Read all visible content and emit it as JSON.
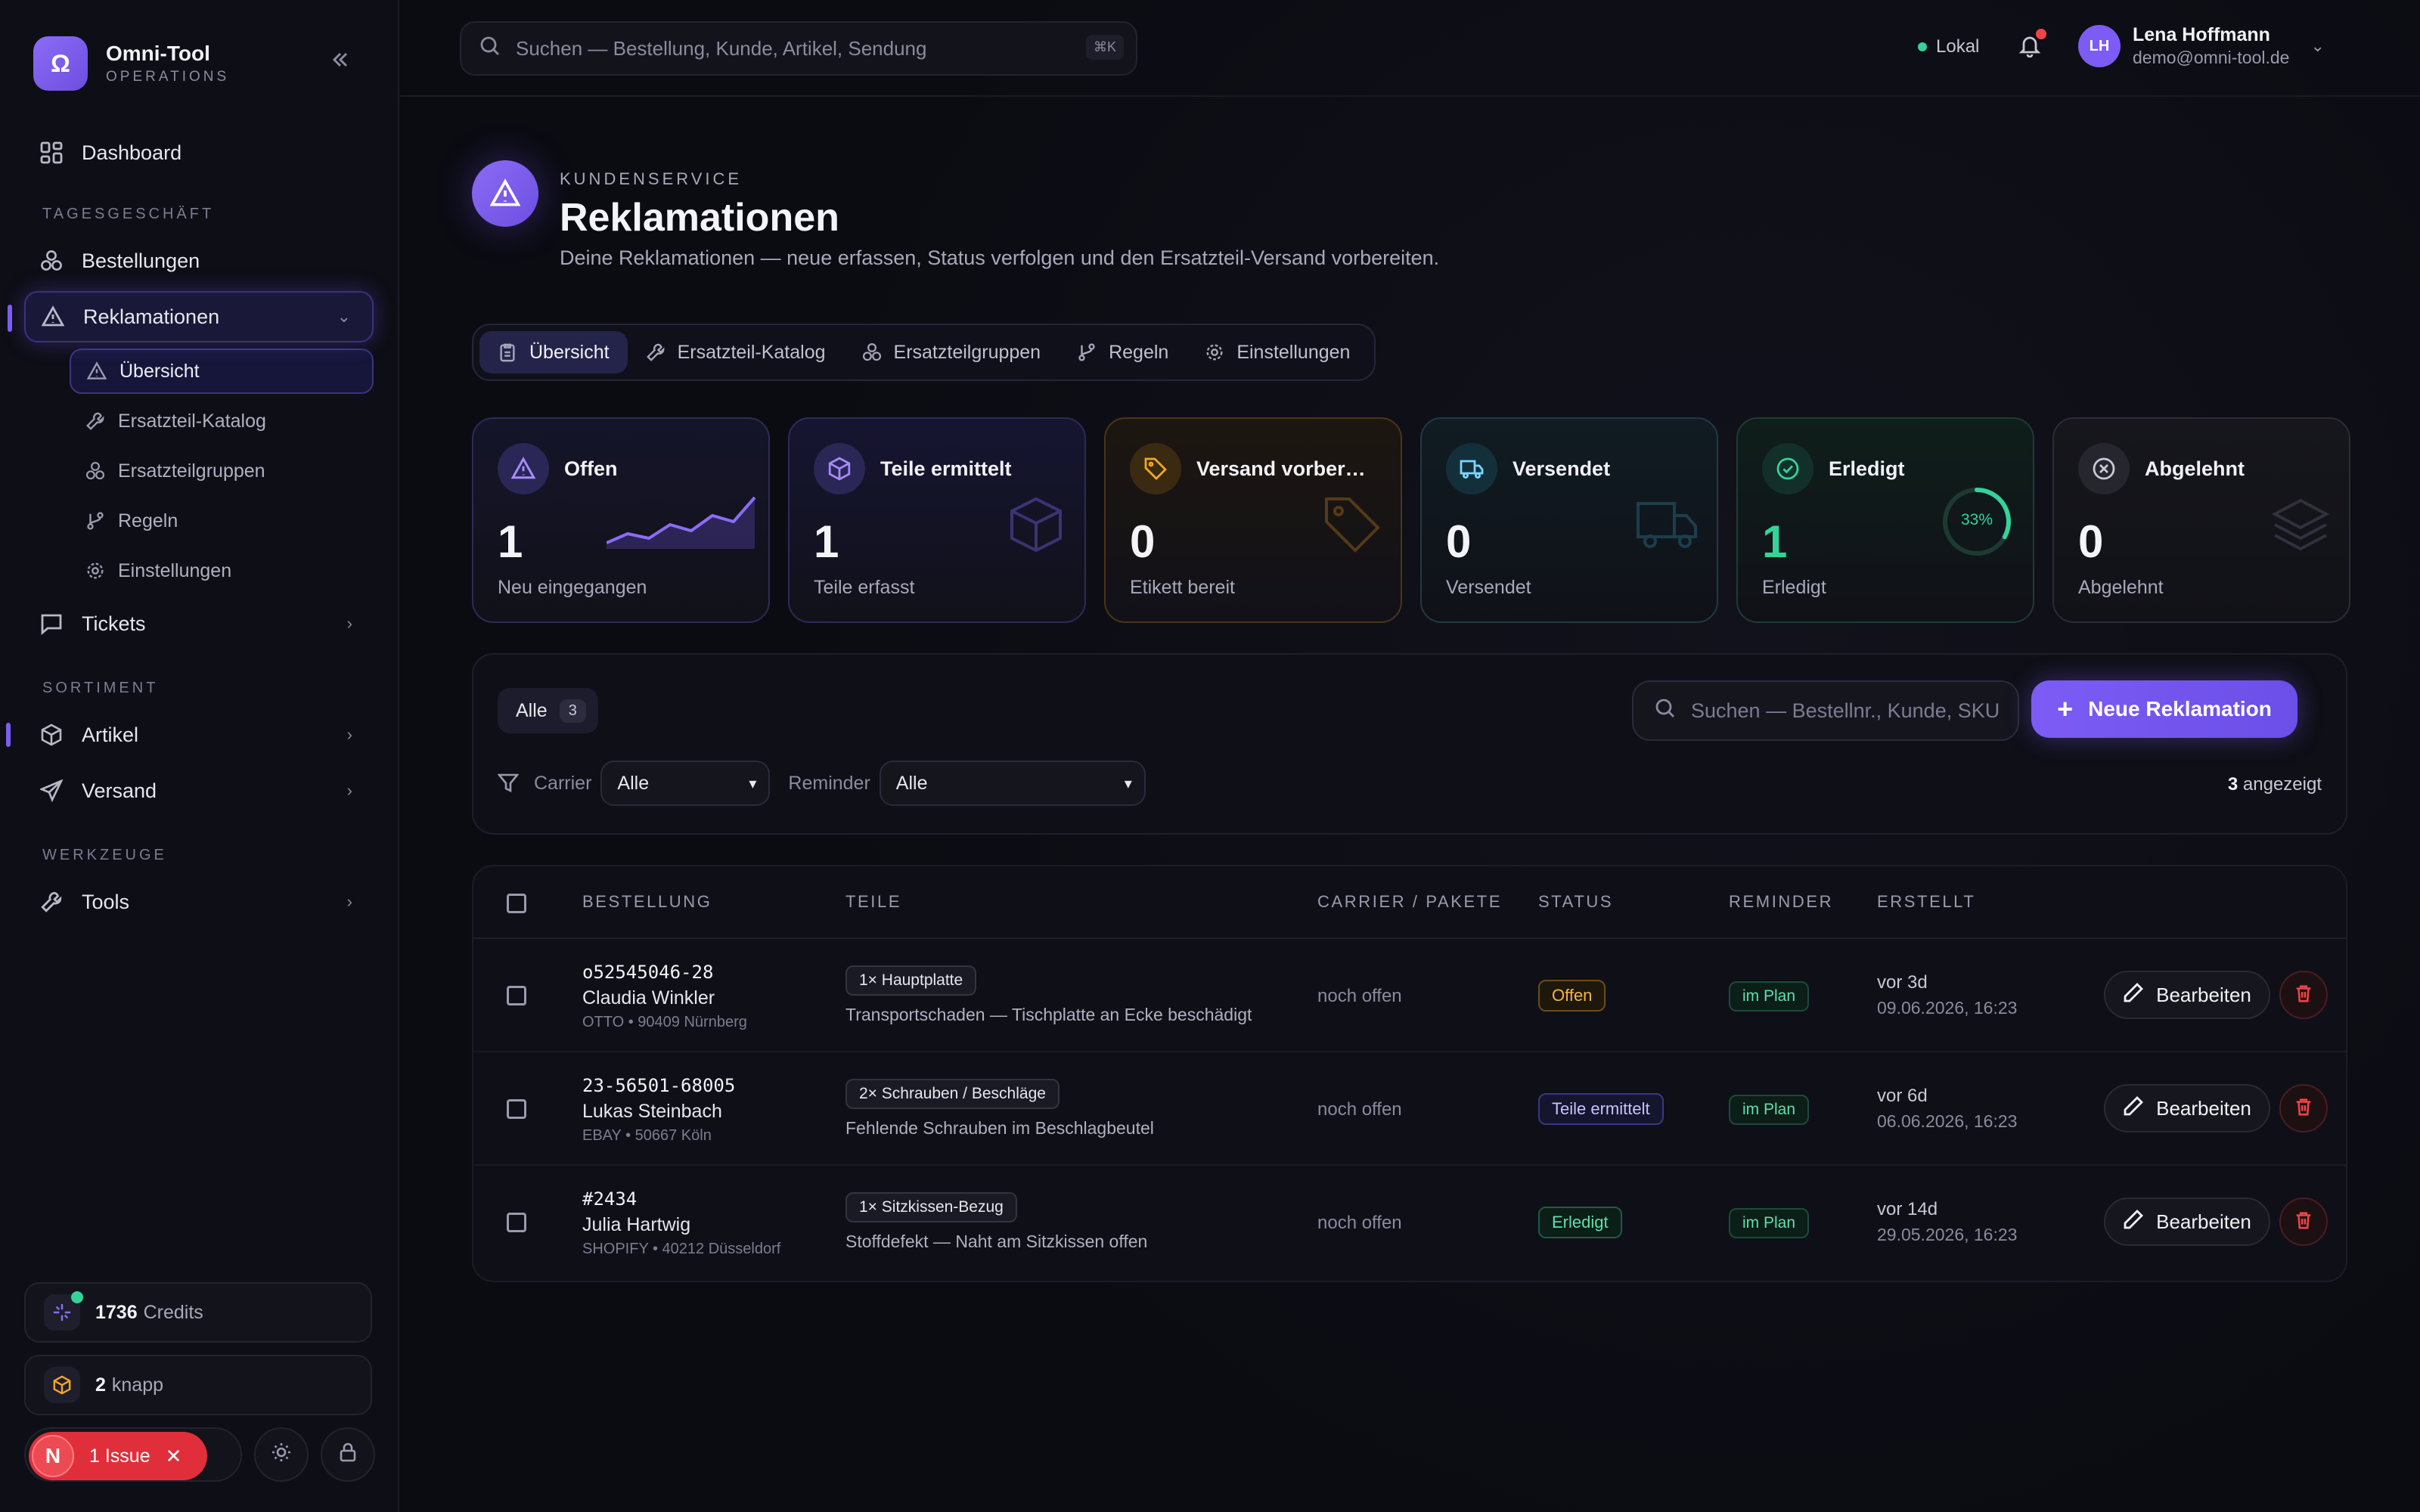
{
  "brand": {
    "name": "Omni-Tool",
    "sub": "OPERATIONS"
  },
  "sidebar": {
    "dashboard": "Dashboard",
    "section_daily": "TAGESGESCHÄFT",
    "bestellungen": "Bestellungen",
    "reklamationen": "Reklamationen",
    "sub_items": [
      "Übersicht",
      "Ersatzteil-Katalog",
      "Ersatzteilgruppen",
      "Regeln",
      "Einstellungen"
    ],
    "tickets": "Tickets",
    "section_sortiment": "SORTIMENT",
    "artikel": "Artikel",
    "versand": "Versand",
    "section_tools": "WERKZEUGE",
    "tools": "Tools",
    "credits_value": "1736",
    "credits_label": "Credits",
    "knapp_value": "2",
    "knapp_label": "knapp",
    "issue_letter": "N",
    "issue_label": "1 Issue"
  },
  "topbar": {
    "search_placeholder": "Suchen — Bestellung, Kunde, Artikel, Sendung",
    "shortcut": "⌘K",
    "env": "Lokal",
    "user_initials": "LH",
    "user_name": "Lena Hoffmann",
    "user_email": "demo@omni-tool.de"
  },
  "page": {
    "eyebrow": "KUNDENSERVICE",
    "title": "Reklamationen",
    "description": "Deine Reklamationen — neue erfassen, Status verfolgen und den Ersatzteil-Versand vorbereiten."
  },
  "tabs": [
    "Übersicht",
    "Ersatzteil-Katalog",
    "Ersatzteilgruppen",
    "Regeln",
    "Einstellungen"
  ],
  "stats": [
    {
      "label": "Offen",
      "value": "1",
      "sub": "Neu eingegangen",
      "color": "#8b6cf6"
    },
    {
      "label": "Teile ermittelt",
      "value": "1",
      "sub": "Teile erfasst",
      "color": "#8b6cf6"
    },
    {
      "label": "Versand vorberei...",
      "value": "0",
      "sub": "Etikett bereit",
      "color": "#f5a524"
    },
    {
      "label": "Versendet",
      "value": "0",
      "sub": "Versendet",
      "color": "#38bdf8"
    },
    {
      "label": "Erledigt",
      "value": "1",
      "sub": "Erledigt",
      "color": "#34d399",
      "progress": "33%"
    },
    {
      "label": "Abgelehnt",
      "value": "0",
      "sub": "Abgelehnt",
      "color": "#9a9aae"
    }
  ],
  "filters": {
    "all_label": "Alle",
    "all_count": "3",
    "search_placeholder": "Suchen — Bestellnr., Kunde, SKU",
    "new_button": "Neue Reklamation",
    "carrier_label": "Carrier",
    "carrier_value": "Alle",
    "reminder_label": "Reminder",
    "reminder_value": "Alle",
    "shown_count": "3",
    "shown_label": "angezeigt"
  },
  "table": {
    "headers": [
      "BESTELLUNG",
      "TEILE",
      "CARRIER / PAKETE",
      "STATUS",
      "REMINDER",
      "ERSTELLT"
    ],
    "rows": [
      {
        "order": "o52545046-28",
        "customer": "Claudia Winkler",
        "meta": "OTTO • 90409 Nürnberg",
        "part": "1× Hauptplatte",
        "desc": "Transportschaden — Tischplatte an Ecke beschädigt",
        "carrier": "noch offen",
        "status": "Offen",
        "reminder": "im Plan",
        "rel": "vor 3d",
        "date": "09.06.2026, 16:23",
        "edit": "Bearbeiten"
      },
      {
        "order": "23-56501-68005",
        "customer": "Lukas Steinbach",
        "meta": "EBAY • 50667 Köln",
        "part": "2× Schrauben / Beschläge",
        "desc": "Fehlende Schrauben im Beschlagbeutel",
        "carrier": "noch offen",
        "status": "Teile ermittelt",
        "reminder": "im Plan",
        "rel": "vor 6d",
        "date": "06.06.2026, 16:23",
        "edit": "Bearbeiten"
      },
      {
        "order": "#2434",
        "customer": "Julia Hartwig",
        "meta": "SHOPIFY • 40212 Düsseldorf",
        "part": "1× Sitzkissen-Bezug",
        "desc": "Stoffdefekt — Naht am Sitzkissen offen",
        "carrier": "noch offen",
        "status": "Erledigt",
        "reminder": "im Plan",
        "rel": "vor 14d",
        "date": "29.05.2026, 16:23",
        "edit": "Bearbeiten"
      }
    ]
  }
}
